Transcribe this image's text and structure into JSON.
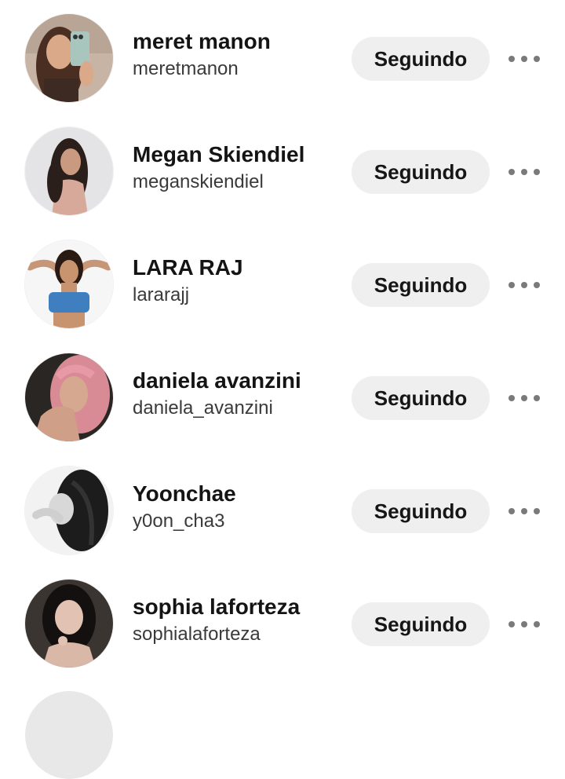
{
  "accounts": [
    {
      "display_name": "meret manon",
      "username": "meretmanon",
      "button_label": "Seguindo"
    },
    {
      "display_name": "Megan Skiendiel",
      "username": "meganskiendiel",
      "button_label": "Seguindo"
    },
    {
      "display_name": "LARA RAJ",
      "username": "lararajj",
      "button_label": "Seguindo"
    },
    {
      "display_name": "daniela avanzini",
      "username": "daniela_avanzini",
      "button_label": "Seguindo"
    },
    {
      "display_name": "Yoonchae",
      "username": "y0on_cha3",
      "button_label": "Seguindo"
    },
    {
      "display_name": "sophia laforteza",
      "username": "sophialaforteza",
      "button_label": "Seguindo"
    }
  ],
  "icons": {
    "more": "more-horizontal-icon"
  },
  "colors": {
    "button_bg": "#efefef",
    "text_primary": "#141414",
    "text_secondary": "#3a3a3a",
    "dots": "#7a7a7a"
  }
}
